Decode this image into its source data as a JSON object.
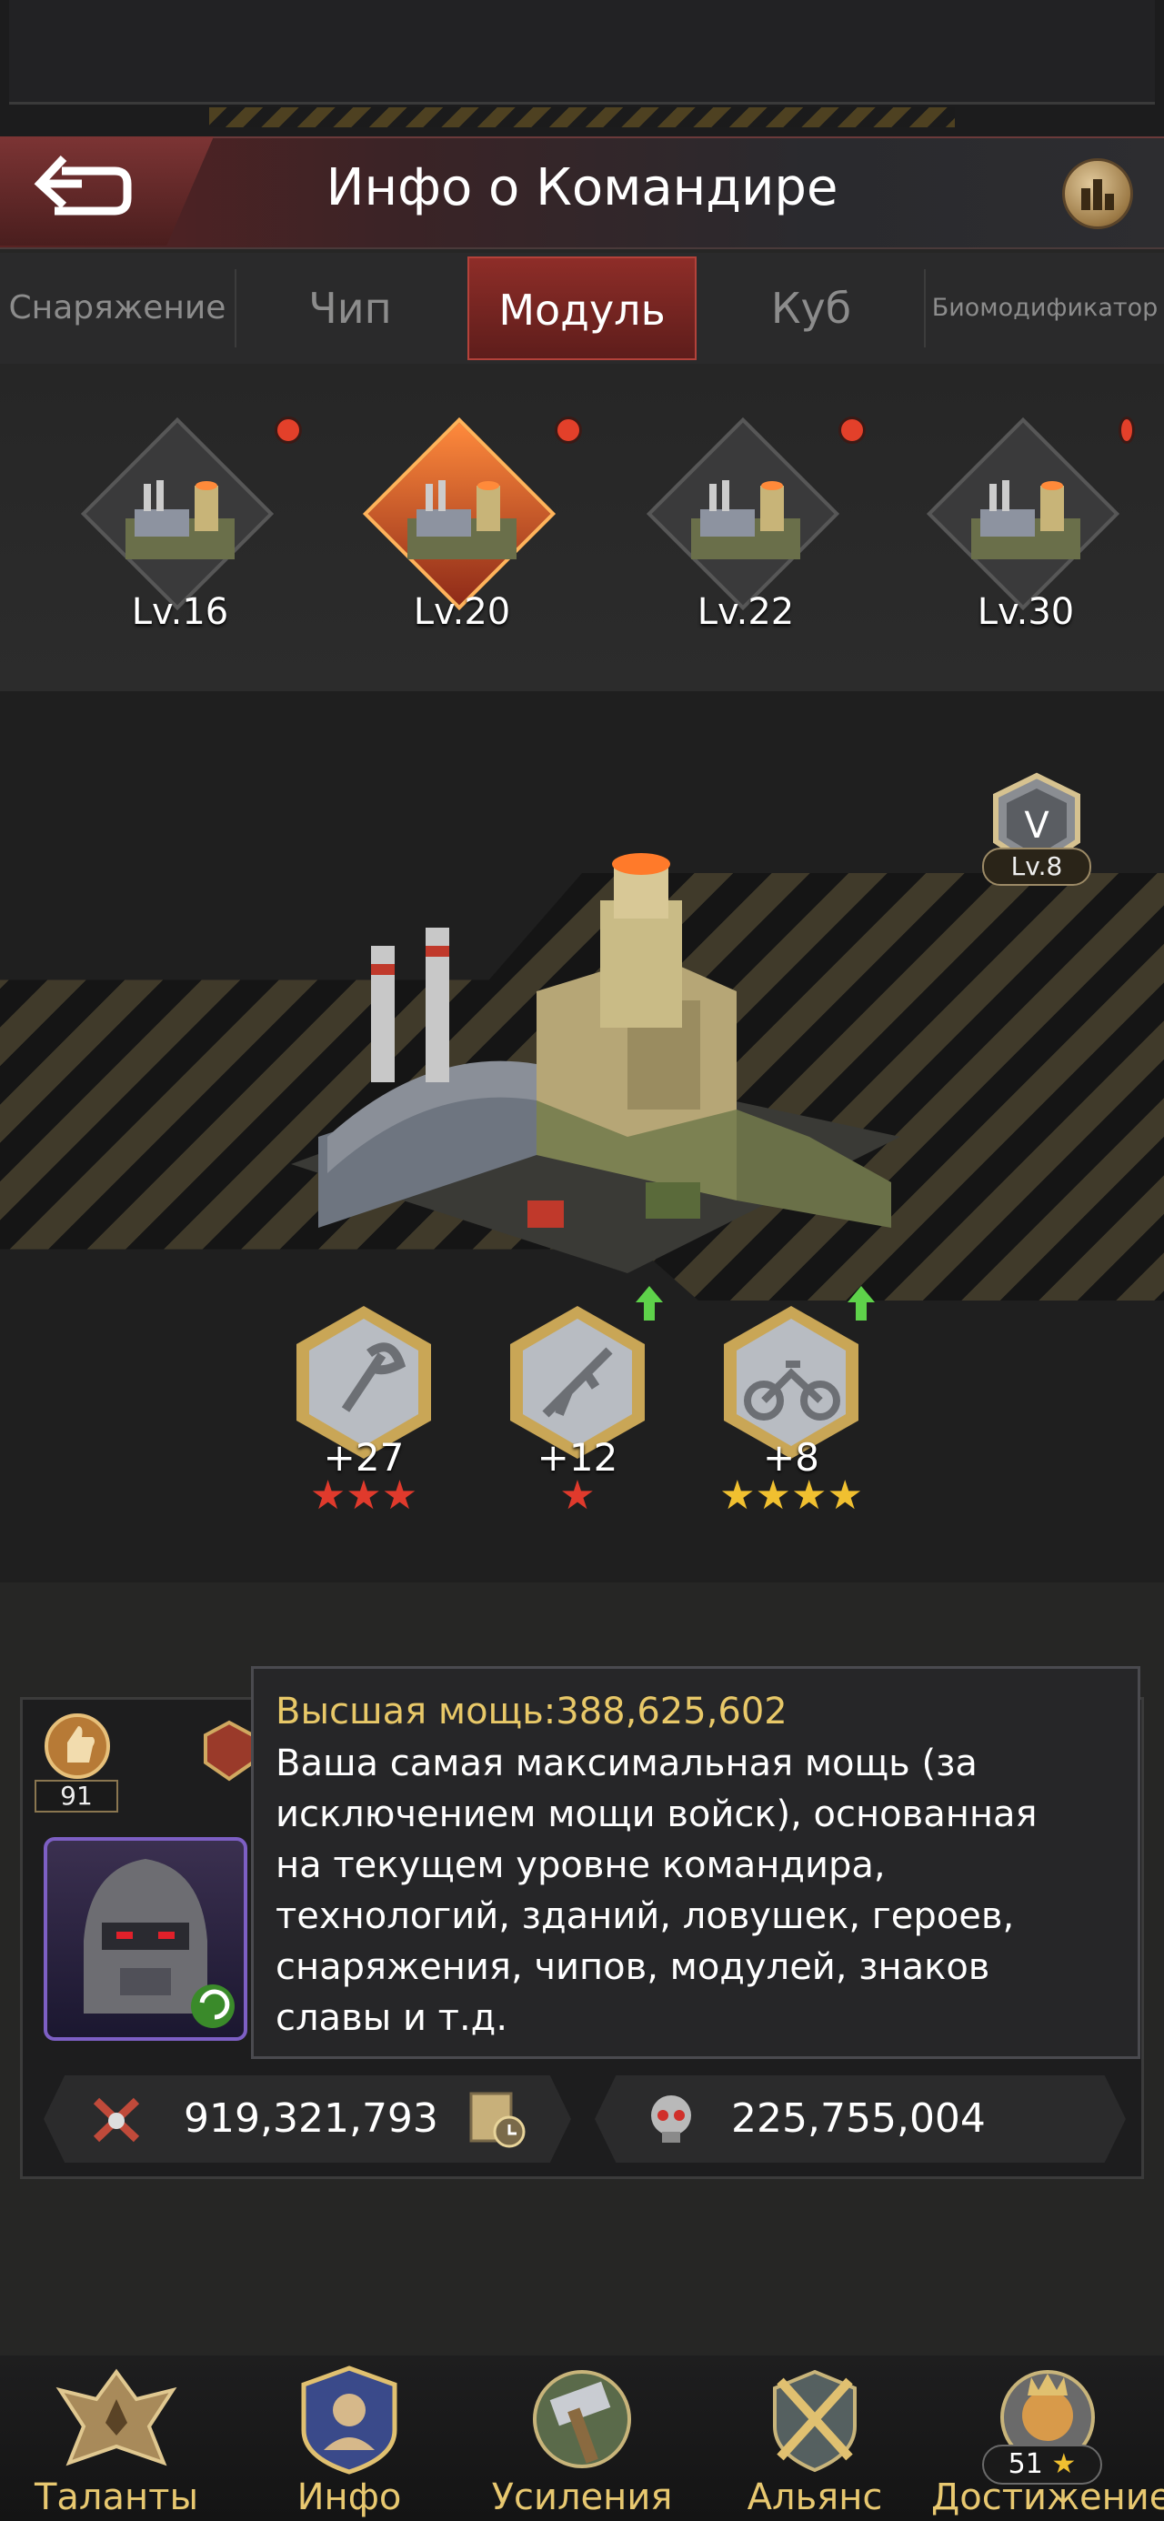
{
  "header": {
    "title": "Инфо о Командире"
  },
  "tabs": [
    {
      "label": "Снаряжение",
      "selected": false
    },
    {
      "label": "Чип",
      "selected": false
    },
    {
      "label": "Модуль",
      "selected": true
    },
    {
      "label": "Куб",
      "selected": false
    },
    {
      "label": "Биомодификатор",
      "selected": false
    }
  ],
  "modules": [
    {
      "level": "Lv.16",
      "selected": false,
      "notification": true
    },
    {
      "level": "Lv.20",
      "selected": true,
      "notification": true
    },
    {
      "level": "Lv.22",
      "selected": false,
      "notification": true
    },
    {
      "level": "Lv.30",
      "selected": false,
      "notification": true
    }
  ],
  "module_detail": {
    "grade_level": "Lv.8",
    "skills": [
      {
        "icon": "axe-icon",
        "value": "+27",
        "stars": 3,
        "star_color": "#e03a2c",
        "upgradable": false
      },
      {
        "icon": "rifle-icon",
        "value": "+12",
        "stars": 1,
        "star_color": "#e03a2c",
        "upgradable": true
      },
      {
        "icon": "motorcycle-icon",
        "value": "+8",
        "stars": 4,
        "star_color": "#f0c030",
        "upgradable": true
      }
    ]
  },
  "commander": {
    "medal_level": "91",
    "tooltip": {
      "title": "Высшая мощь:388,625,602",
      "lines": [
        "Ваша самая максимальная мощь (за",
        "исключением мощи войск), основанная",
        "на текущем уровне командира,",
        "технологий, зданий, ловушек, героев,",
        "снаряжения, чипов, модулей, знаков",
        "славы и т.д."
      ]
    },
    "stats": [
      {
        "icon": "crossed-guns-icon",
        "value": "919,321,793"
      },
      {
        "icon": "skull-mask-icon",
        "value": "225,755,004"
      }
    ]
  },
  "bottom_nav": [
    {
      "label": "Таланты",
      "icon": "eagle-emblem-icon"
    },
    {
      "label": "Инфо",
      "icon": "commander-shield-icon"
    },
    {
      "label": "Усиления",
      "icon": "hammer-icon"
    },
    {
      "label": "Альянс",
      "icon": "crossed-swords-icon"
    },
    {
      "label": "Достижение",
      "icon": "lion-crest-icon",
      "count": "51"
    }
  ],
  "colors": {
    "accent_red": "#8e2d28",
    "gold_text": "#e8c868",
    "star_red": "#e03a2c",
    "star_gold": "#f0c030"
  }
}
